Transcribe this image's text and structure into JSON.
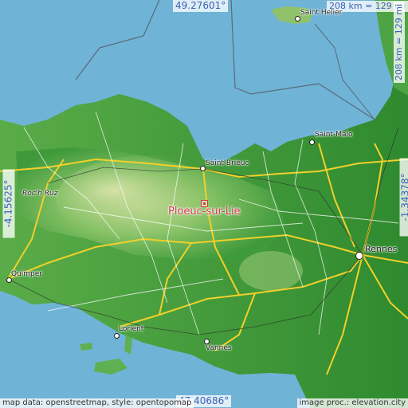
{
  "map": {
    "coords": {
      "top": "49.27601°",
      "bottom": "47.40686°",
      "left": "-4.15625°",
      "right": "-1.34378°"
    },
    "scale": {
      "horizontal": "208 km = 129 mi",
      "vertical": "208 km = 129 mi"
    },
    "place": {
      "name": "Ploeuc-sur-Lie",
      "color": "#d23a4a"
    },
    "cities": [
      {
        "name": "Saint Helier",
        "size": "small"
      },
      {
        "name": "Saint-Malo",
        "size": "small"
      },
      {
        "name": "Saint-Brieuc",
        "size": "small"
      },
      {
        "name": "Roc'h Ruz",
        "size": "peak"
      },
      {
        "name": "Quimper",
        "size": "small"
      },
      {
        "name": "Rennes",
        "size": "big"
      },
      {
        "name": "Lorient",
        "size": "small"
      },
      {
        "name": "Vannes",
        "size": "small"
      }
    ],
    "attribution": {
      "left": "map data: openstreetmap, style: opentopomap",
      "right": "image proc.: elevation.city"
    },
    "colors": {
      "sea": "#6fb3d6",
      "land_low": "#3f9a3a",
      "land_high": "#cfe0a0",
      "roads": "#f2d02a",
      "boundary": "#5a6a7a"
    }
  }
}
